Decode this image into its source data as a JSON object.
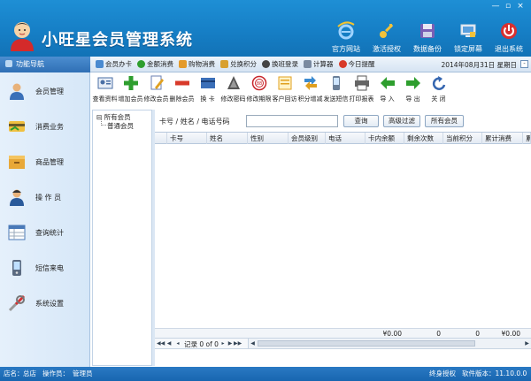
{
  "app": {
    "title": "小旺星会员管理系统"
  },
  "window_controls": [
    "—",
    "▫",
    "×"
  ],
  "top_tools": [
    {
      "label": "官方网站",
      "icon": "ie-icon"
    },
    {
      "label": "激活授权",
      "icon": "key-icon"
    },
    {
      "label": "数据备份",
      "icon": "floppy-icon"
    },
    {
      "label": "锁定屏幕",
      "icon": "lock-screen-icon"
    },
    {
      "label": "退出系统",
      "icon": "power-icon"
    }
  ],
  "nav_header": "功能导航",
  "quick_toolbar": [
    {
      "label": "会员办卡",
      "icon": "card-icon"
    },
    {
      "label": "金额消费",
      "icon": "money-icon"
    },
    {
      "label": "购物消费",
      "icon": "cart-icon"
    },
    {
      "label": "兑换积分",
      "icon": "exchange-icon"
    },
    {
      "label": "换班登录",
      "icon": "shift-icon"
    },
    {
      "label": "计算器",
      "icon": "calculator-icon"
    },
    {
      "label": "今日提醒",
      "icon": "alarm-icon"
    }
  ],
  "date_display": "2014年08月31日  星期日",
  "sidebar": {
    "items": [
      {
        "label": "会员管理",
        "icon": "member-icon"
      },
      {
        "label": "消费业务",
        "icon": "consume-icon"
      },
      {
        "label": "商品管理",
        "icon": "goods-icon"
      },
      {
        "label": "操 作 员",
        "icon": "operator-icon"
      },
      {
        "label": "查询统计",
        "icon": "report-icon"
      },
      {
        "label": "短信来电",
        "icon": "phone-icon"
      },
      {
        "label": "系统设置",
        "icon": "settings-icon"
      }
    ]
  },
  "main_toolbar": [
    {
      "label": "查看资料",
      "icon": "view-profile-icon",
      "color": "#4a6fa5"
    },
    {
      "label": "增加会员",
      "icon": "add-icon",
      "color": "#2e9e2e"
    },
    {
      "label": "修改会员",
      "icon": "edit-icon",
      "color": "#6a7fb0"
    },
    {
      "label": "删除会员",
      "icon": "delete-icon",
      "color": "#d83a2a"
    },
    {
      "label": "换  卡",
      "icon": "change-card-icon",
      "color": "#3b6fb8"
    },
    {
      "label": "修改密码",
      "icon": "password-icon",
      "color": "#555555"
    },
    {
      "label": "修改期限",
      "icon": "expiry-icon",
      "color": "#c8262b"
    },
    {
      "label": "客户回访",
      "icon": "revisit-icon",
      "color": "#e0a020"
    },
    {
      "label": "积分增减",
      "icon": "points-icon",
      "color": "#3b8ad0"
    },
    {
      "label": "发送短信",
      "icon": "sms-icon",
      "color": "#6a7f99"
    },
    {
      "label": "打印报表",
      "icon": "print-icon",
      "color": "#555555"
    },
    {
      "label": "导  入",
      "icon": "import-icon",
      "color": "#2e9e2e"
    },
    {
      "label": "导  出",
      "icon": "export-icon",
      "color": "#2e9e2e"
    },
    {
      "label": "关  闭",
      "icon": "close-icon",
      "color": "#3566b0"
    }
  ],
  "tree": {
    "root": "所有会员",
    "child": "普通会员"
  },
  "search": {
    "label": "卡号 / 姓名 / 电话号码",
    "value": "",
    "query_button": "查询",
    "advanced_button": "高级过滤",
    "all_button": "所有会员"
  },
  "grid": {
    "columns": [
      "卡号",
      "姓名",
      "性别",
      "会员级别",
      "电话",
      "卡内余额",
      "剩余次数",
      "当前积分",
      "累计消费",
      "累"
    ],
    "rows": [],
    "footer": [
      "¥0.00",
      "0",
      "0",
      "¥0.00"
    ]
  },
  "pager": {
    "text": "记录 0 of 0"
  },
  "status": {
    "shop_label": "店名：",
    "shop_value": "总店",
    "operator_label": "操作员：",
    "operator_value": "管理员",
    "license": "终身授权",
    "version": "软件版本：11.10.0.0"
  },
  "colors": {
    "header_blue": "#167fc6",
    "status_blue": "#1866b0",
    "sidebar_bg": "#d6e7f8"
  }
}
